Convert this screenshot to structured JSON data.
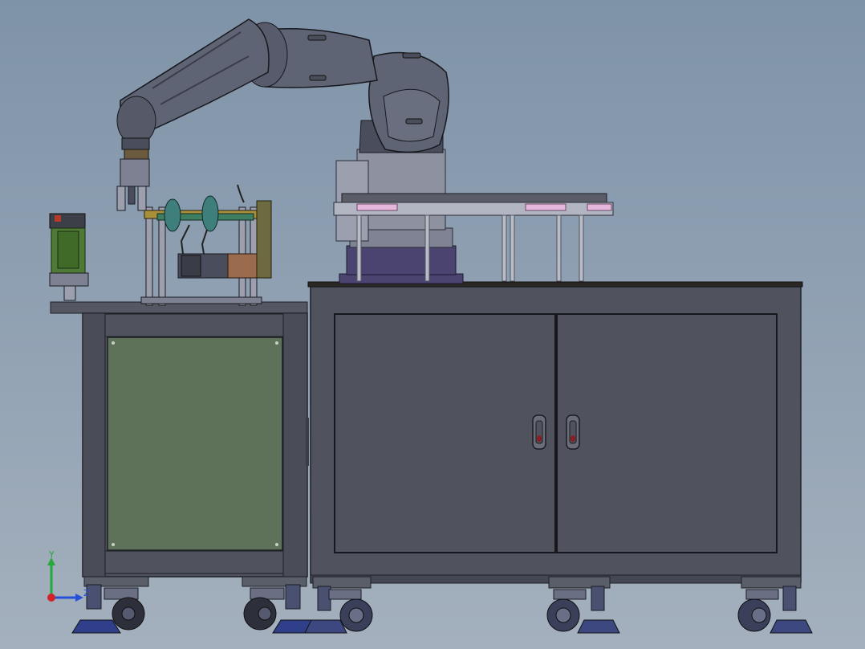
{
  "viewport": {
    "background_top": "#7f93a8",
    "background_bottom": "#a4b0bd"
  },
  "model": {
    "components": [
      "robot-arm",
      "gripper",
      "fixture-station",
      "test-rig-shaft",
      "motor",
      "small-cabinet",
      "large-cabinet",
      "tray-rack",
      "casters",
      "leveling-feet"
    ],
    "colors": {
      "cabinet": "#50535e",
      "cabinet_dark": "#3a3d46",
      "panel_green": "#5d7259",
      "robot": "#5f6474",
      "base_purple": "#4b4470",
      "rail_pink": "#e6b7dc",
      "fixture_green": "#4f7a35",
      "motor_copper": "#9a6b4c",
      "caster": "#3e4460"
    }
  },
  "triad": {
    "icon": "coordinate-triad-icon",
    "axis_y": "Y",
    "axis_z": "Z",
    "color_y": "#26a83c",
    "color_z": "#2850d8",
    "color_x": "#d2232a"
  }
}
